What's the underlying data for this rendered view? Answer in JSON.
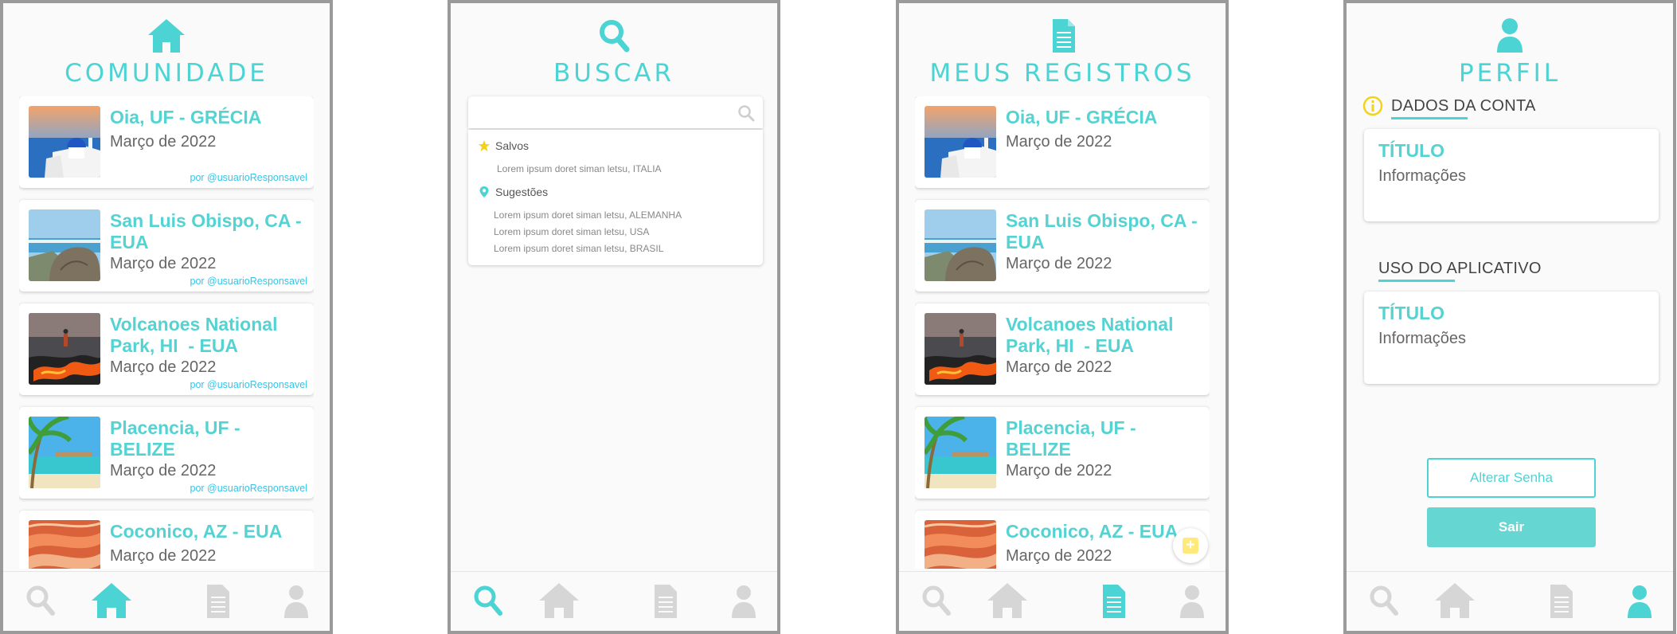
{
  "colors": {
    "accent": "#4cd4d4",
    "nav_inactive": "#d6d6d6",
    "link": "#35c5e8",
    "warning": "#f5d21a"
  },
  "screens": {
    "comunidade": {
      "title": "COMUNIDADE",
      "icon": "home-icon"
    },
    "buscar": {
      "title": "BUSCAR",
      "icon": "search-icon"
    },
    "registros": {
      "title": "MEUS REGISTROS",
      "icon": "document-icon"
    },
    "perfil": {
      "title": "PERFIL",
      "icon": "user-icon"
    }
  },
  "feed": {
    "posts": [
      {
        "title": "Oia, UF - GRÉCIA",
        "date": "Março de 2022",
        "author": "por @usuarioResponsavel",
        "image": "santorini"
      },
      {
        "title": "San Luis Obispo, CA - EUA",
        "date": "Março de 2022",
        "author": "por @usuarioResponsavel",
        "image": "coast"
      },
      {
        "title": "Volcanoes National Park, HI  - EUA",
        "date": "Março de 2022",
        "author": "por @usuarioResponsavel",
        "image": "lava"
      },
      {
        "title": "Placencia, UF - BELIZE",
        "date": "Março de 2022",
        "author": "por @usuarioResponsavel",
        "image": "beach"
      },
      {
        "title": "Coconico, AZ - EUA",
        "date": "Março de 2022",
        "author": "",
        "image": "canyon"
      }
    ]
  },
  "search": {
    "placeholder": "",
    "saved_label": "Salvos",
    "saved_items": [
      "Lorem ipsum doret siman letsu, ITALIA"
    ],
    "suggestions_label": "Sugestões",
    "suggestions": [
      "Lorem ipsum doret siman letsu, ALEMANHA",
      "Lorem ipsum doret siman letsu, USA",
      "Lorem ipsum doret siman letsu, BRASIL"
    ]
  },
  "profile": {
    "account_section": "DADOS DA CONTA",
    "app_section": "USO DO APLICATIVO",
    "card1": {
      "title": "TÍTULO",
      "info": "Informações"
    },
    "card2": {
      "title": "TÍTULO",
      "info": "Informações"
    },
    "change_password": "Alterar Senha",
    "logout": "Sair"
  },
  "fab_label": "+",
  "nav": [
    "search-icon",
    "home-icon",
    "document-icon",
    "user-icon"
  ]
}
